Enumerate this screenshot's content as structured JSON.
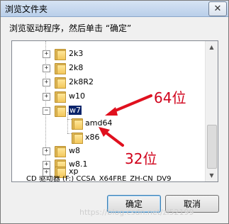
{
  "dialog": {
    "title": "浏览文件夹",
    "close_label": "✕",
    "instruction": "浏览驱动程序，然后单击 “确定”"
  },
  "tree": {
    "items": [
      {
        "label": "2k3",
        "expander": "+",
        "expanded": false,
        "level": 0
      },
      {
        "label": "2k8",
        "expander": "+",
        "expanded": false,
        "level": 0
      },
      {
        "label": "2k8R2",
        "expander": "+",
        "expanded": false,
        "level": 0
      },
      {
        "label": "w10",
        "expander": "+",
        "expanded": false,
        "level": 0
      },
      {
        "label": "w7",
        "expander": "−",
        "expanded": true,
        "selected": true,
        "level": 0
      },
      {
        "label": "amd64",
        "level": 1
      },
      {
        "label": "x86",
        "level": 1
      },
      {
        "label": "w8",
        "expander": "+",
        "expanded": false,
        "level": 0
      },
      {
        "label": "w8.1",
        "expander": "+",
        "expanded": false,
        "level": 0
      },
      {
        "label": "xp",
        "expander": "+",
        "expanded": false,
        "level": 0
      }
    ],
    "partial_bottom_item": "CD 驱动器 (F:) CCSA_X64FRE_ZH-CN_DV9"
  },
  "buttons": {
    "ok": "确定",
    "cancel": "取消"
  },
  "annotations": {
    "arrow_64": "64位",
    "arrow_32": "32位",
    "color": "#d0021b"
  },
  "watermark": "https://blog.csdn.net/zl52199"
}
